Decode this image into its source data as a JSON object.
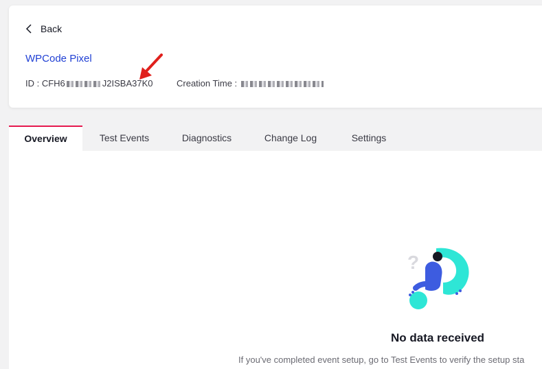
{
  "header": {
    "back_label": "Back",
    "pixel_name": "WPCode Pixel",
    "id_label": "ID : ",
    "id_prefix": "CFH6",
    "id_suffix": "J2ISBA37K0",
    "creation_label": "Creation Time : "
  },
  "tabs": [
    {
      "label": "Overview",
      "active": true
    },
    {
      "label": "Test Events",
      "active": false
    },
    {
      "label": "Diagnostics",
      "active": false
    },
    {
      "label": "Change Log",
      "active": false
    },
    {
      "label": "Settings",
      "active": false
    }
  ],
  "empty_state": {
    "title": "No data received",
    "description": "If you've completed event setup, go to Test Events to verify the setup sta"
  },
  "colors": {
    "accent": "#e5184e",
    "link": "#1f3fd4",
    "annotation_arrow": "#e0201c",
    "illustration_teal": "#2ee6d6",
    "illustration_blue": "#3d5ce0"
  },
  "icons": {
    "back": "chevron-left-icon",
    "annotation": "red-arrow-icon",
    "illustration": "no-data-illustration"
  }
}
